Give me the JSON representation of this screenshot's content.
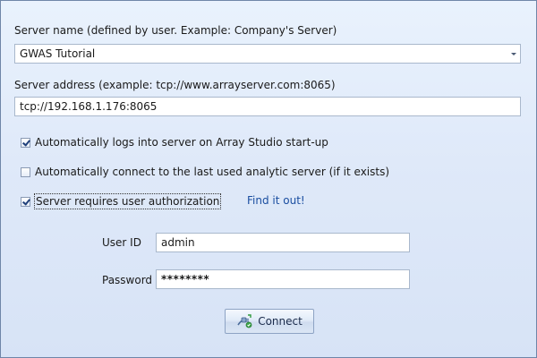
{
  "server_name": {
    "label": "Server name (defined by user. Example: Company's Server)",
    "selected_value": "GWAS Tutorial"
  },
  "server_address": {
    "label": "Server address (example: tcp://www.arrayserver.com:8065)",
    "value": "tcp://192.168.1.176:8065"
  },
  "options": {
    "auto_login": {
      "label": "Automatically logs into server on Array Studio start-up",
      "checked": true
    },
    "auto_connect_analytic": {
      "label": "Automatically connect to the last used analytic server (if it exists)",
      "checked": false
    },
    "requires_auth": {
      "label": "Server requires user authorization",
      "checked": true
    }
  },
  "find_link": "Find it out!",
  "credentials": {
    "user_id_label": "User ID",
    "user_id_value": "admin",
    "password_label": "Password",
    "password_value": "********"
  },
  "connect_button": {
    "label": "Connect",
    "icon": "plug-connect-icon"
  },
  "colors": {
    "background_top": "#e9f2fd",
    "background_bottom": "#d7e3f6",
    "link": "#1a4ea0",
    "check_mark": "#1f3f7a"
  }
}
